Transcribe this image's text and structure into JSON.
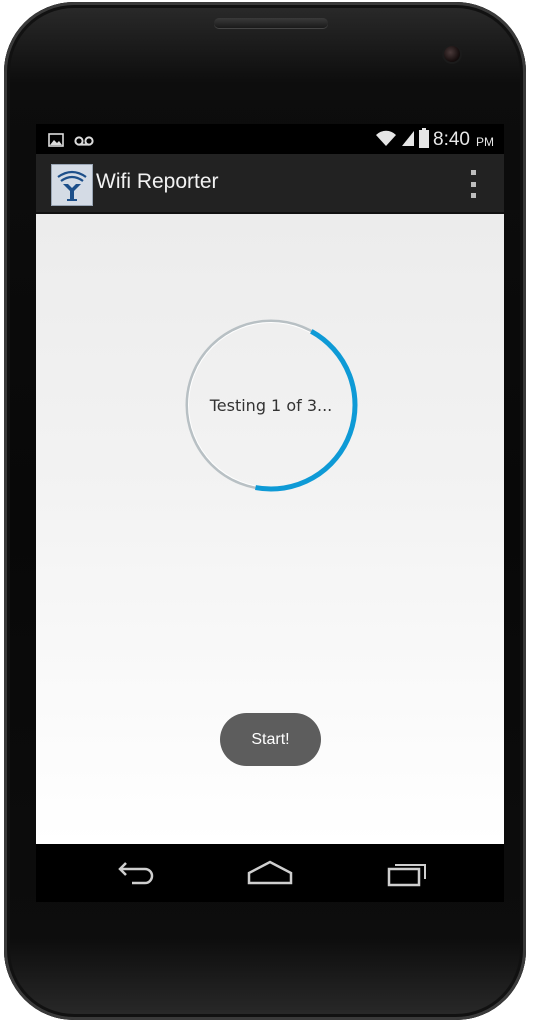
{
  "status_bar": {
    "left_icons": [
      "image-icon",
      "voicemail-icon"
    ],
    "right_icons": [
      "wifi-icon",
      "signal-icon",
      "battery-icon"
    ],
    "time": "8:40",
    "ampm": "PM"
  },
  "action_bar": {
    "app_icon": "wifi-reporter-logo-icon",
    "title": "Wifi Reporter",
    "menu_icon": "overflow-menu-icon"
  },
  "main": {
    "progress": {
      "text": "Testing 1 of 3...",
      "fraction": 0.45,
      "accent_color": "#0e9ad6"
    },
    "start_button": {
      "label": "Start!"
    }
  },
  "nav_bar": {
    "buttons": [
      "back-icon",
      "home-icon",
      "recent-apps-icon"
    ]
  }
}
